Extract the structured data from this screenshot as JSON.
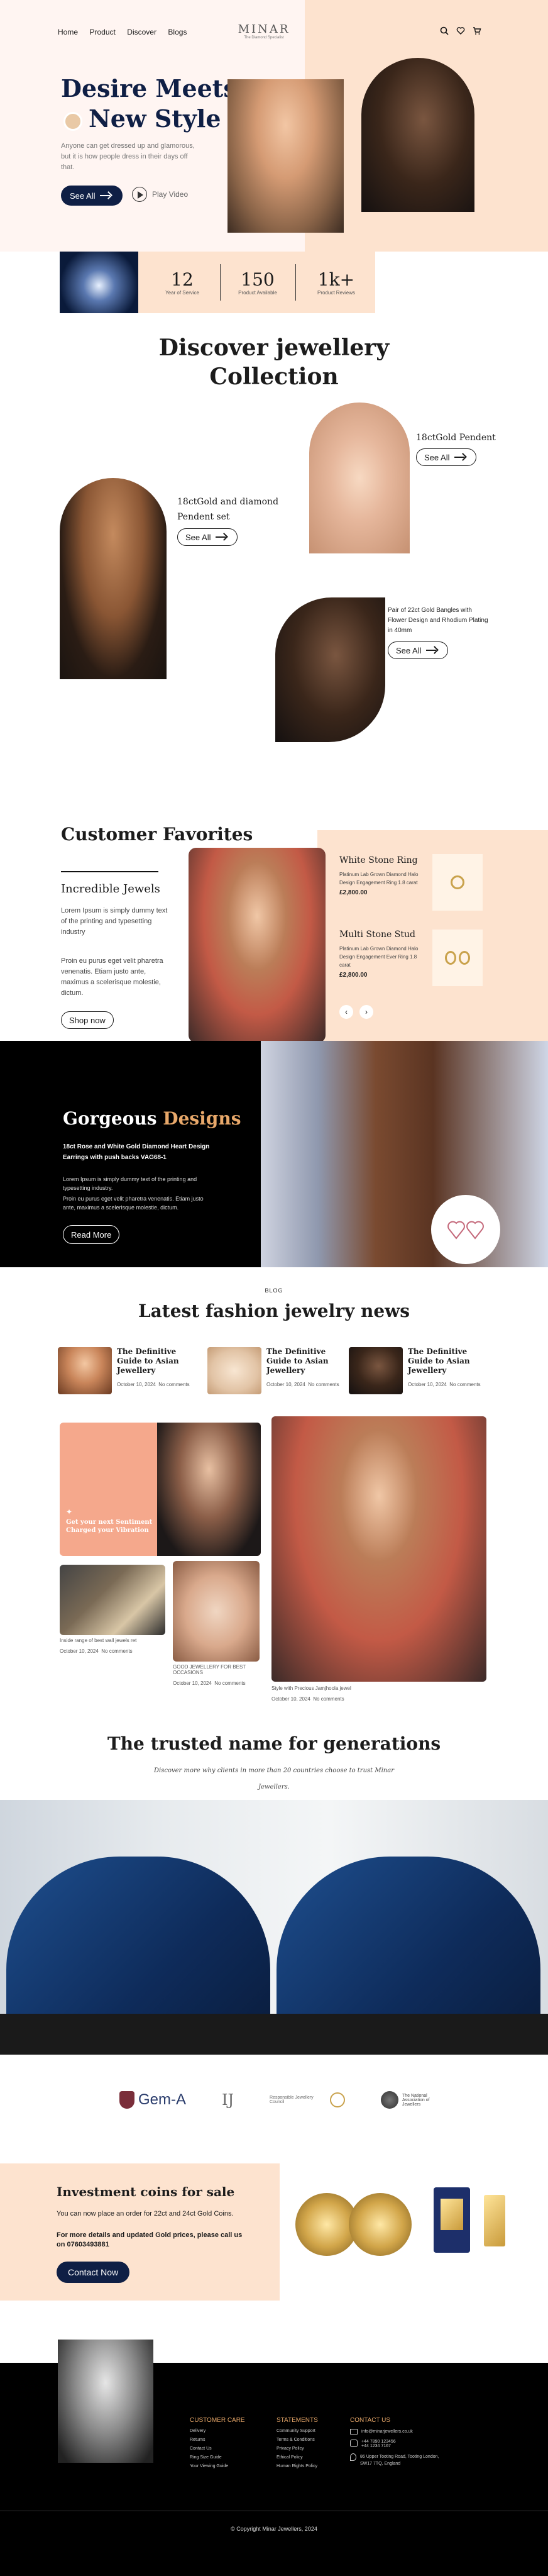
{
  "nav": {
    "links": [
      "Home",
      "Product",
      "Discover",
      "Blogs"
    ],
    "brand": "MINAR",
    "brand_tagline": "The Diamond Specialist"
  },
  "hero": {
    "title_line1": "Desire Meets",
    "title_line2": "New Style",
    "paragraph": "Anyone can get dressed up and glamorous, but it is how people dress in their days off that.",
    "see_all": "See All",
    "play_video": "Play Video"
  },
  "stats": [
    {
      "value": "12",
      "label": "Year of Service"
    },
    {
      "value": "150",
      "label": "Product Available"
    },
    {
      "value": "1k+",
      "label": "Product Reviews"
    }
  ],
  "discover": {
    "title_line1": "Discover jewellery",
    "title_line2": "Collection",
    "item1_title": "18ctGold Pendent",
    "item1_button": "See All",
    "item2_title_line1": "18ctGold and diamond",
    "item2_title_line2": "Pendent set",
    "item2_button": "See All",
    "item3_title_line1": "Pair of 22ct Gold Bangles with",
    "item3_title_line2": "Flower Design and Rhodium Plating",
    "item3_title_line3": "in 40mm",
    "item3_button": "See All"
  },
  "favorites": {
    "title": "Customer Favorites",
    "sub_title": "Incredible Jewels",
    "para1": "Lorem Ipsum is simply dummy text of the printing and typesetting industry",
    "para2": "Proin eu purus eget velit pharetra venenatis. Etiam justo ante, maximus a scelerisque molestie, dictum.",
    "shop_now": "Shop now",
    "products": [
      {
        "name": "White Stone Ring",
        "desc": "Platinum Lab Grown Diamond Halo Design Engagement Ring 1.8 carat",
        "price": "£2,800.00"
      },
      {
        "name": "Multi Stone Stud",
        "desc": "Platinum Lab Grown Diamond Halo Design Engagement Ever Ring 1.8 carat",
        "price": "£2,800.00"
      }
    ]
  },
  "gorgeous": {
    "title_white": "Gorgeous",
    "title_accent": "Designs",
    "subtitle": "18ct Rose and White Gold Diamond Heart Design Earrings with push backs VAG68-1",
    "para1": "Lorem Ipsum is simply dummy text of the printing and typesetting industry.",
    "para2": "Proin eu purus eget velit pharetra venenatis. Etiam justo ante, maximus a scelerisque molestie, dictum.",
    "read_more": "Read More"
  },
  "blog": {
    "kicker": "BLOG",
    "title": "Latest fashion jewelry news",
    "posts": [
      {
        "title": "The Definitive Guide to Asian Jewellery",
        "date": "October 10, 2024",
        "comments": "No comments"
      },
      {
        "title": "The Definitive Guide to Asian Jewellery",
        "date": "October 10, 2024",
        "comments": "No comments"
      },
      {
        "title": "The Definitive Guide to Asian Jewellery",
        "date": "October 10, 2024",
        "comments": "No comments"
      }
    ],
    "promo_text": "Get your next Sentiment Charged your Vibration",
    "card1_caption": "Inside range of best wall jewels ret",
    "card1_date": "October 10, 2024",
    "card1_comments": "No comments",
    "card2_caption": "GOOD JEWELLERY FOR BEST OCCASIONS",
    "card2_date": "October 10, 2024",
    "card2_comments": "No comments",
    "card3_caption": "Style with Precious Jamjhoola jewel",
    "card3_date": "October 10, 2024",
    "card3_comments": "No comments"
  },
  "trusted": {
    "title": "The trusted name for generations",
    "subtitle_line1": "Discover more why clients in more than 20 countries choose to trust Minar",
    "subtitle_line2": "Jewellers."
  },
  "partners": [
    "Gem-A",
    "IJ",
    "Responsible Jewellery Council",
    "The National Association of Jewellers"
  ],
  "coins": {
    "title": "Investment coins for sale",
    "line1": "You can now place an order for 22ct and 24ct Gold Coins.",
    "line2": "For more details and updated Gold prices, please call us on 07603493881",
    "button": "Contact Now"
  },
  "footer": {
    "col1_title": "CUSTOMER CARE",
    "col1_items": [
      "Delivery",
      "Returns",
      "Contact Us",
      "Ring Size Guide",
      "Your Viewing Guide"
    ],
    "col2_title": "STATEMENTS",
    "col2_items": [
      "Community Support",
      "Terms & Conditions",
      "Privacy Policy",
      "Ethical Policy",
      "Human Rights Policy"
    ],
    "col3_title": "CONTACT US",
    "email": "info@minarjewellers.co.uk",
    "phone1": "+44 7890 123456",
    "phone2": "+44 1234 7167",
    "address": "86 Upper Tooting Road, Tooting London, SW17 7TQ, England",
    "copyright": "© Copyright Minar Jewellers, 2024"
  },
  "colors": {
    "peach": "#fde3cf",
    "navy": "#0f1f45",
    "black": "#000000",
    "gold": "#e8a86a"
  }
}
